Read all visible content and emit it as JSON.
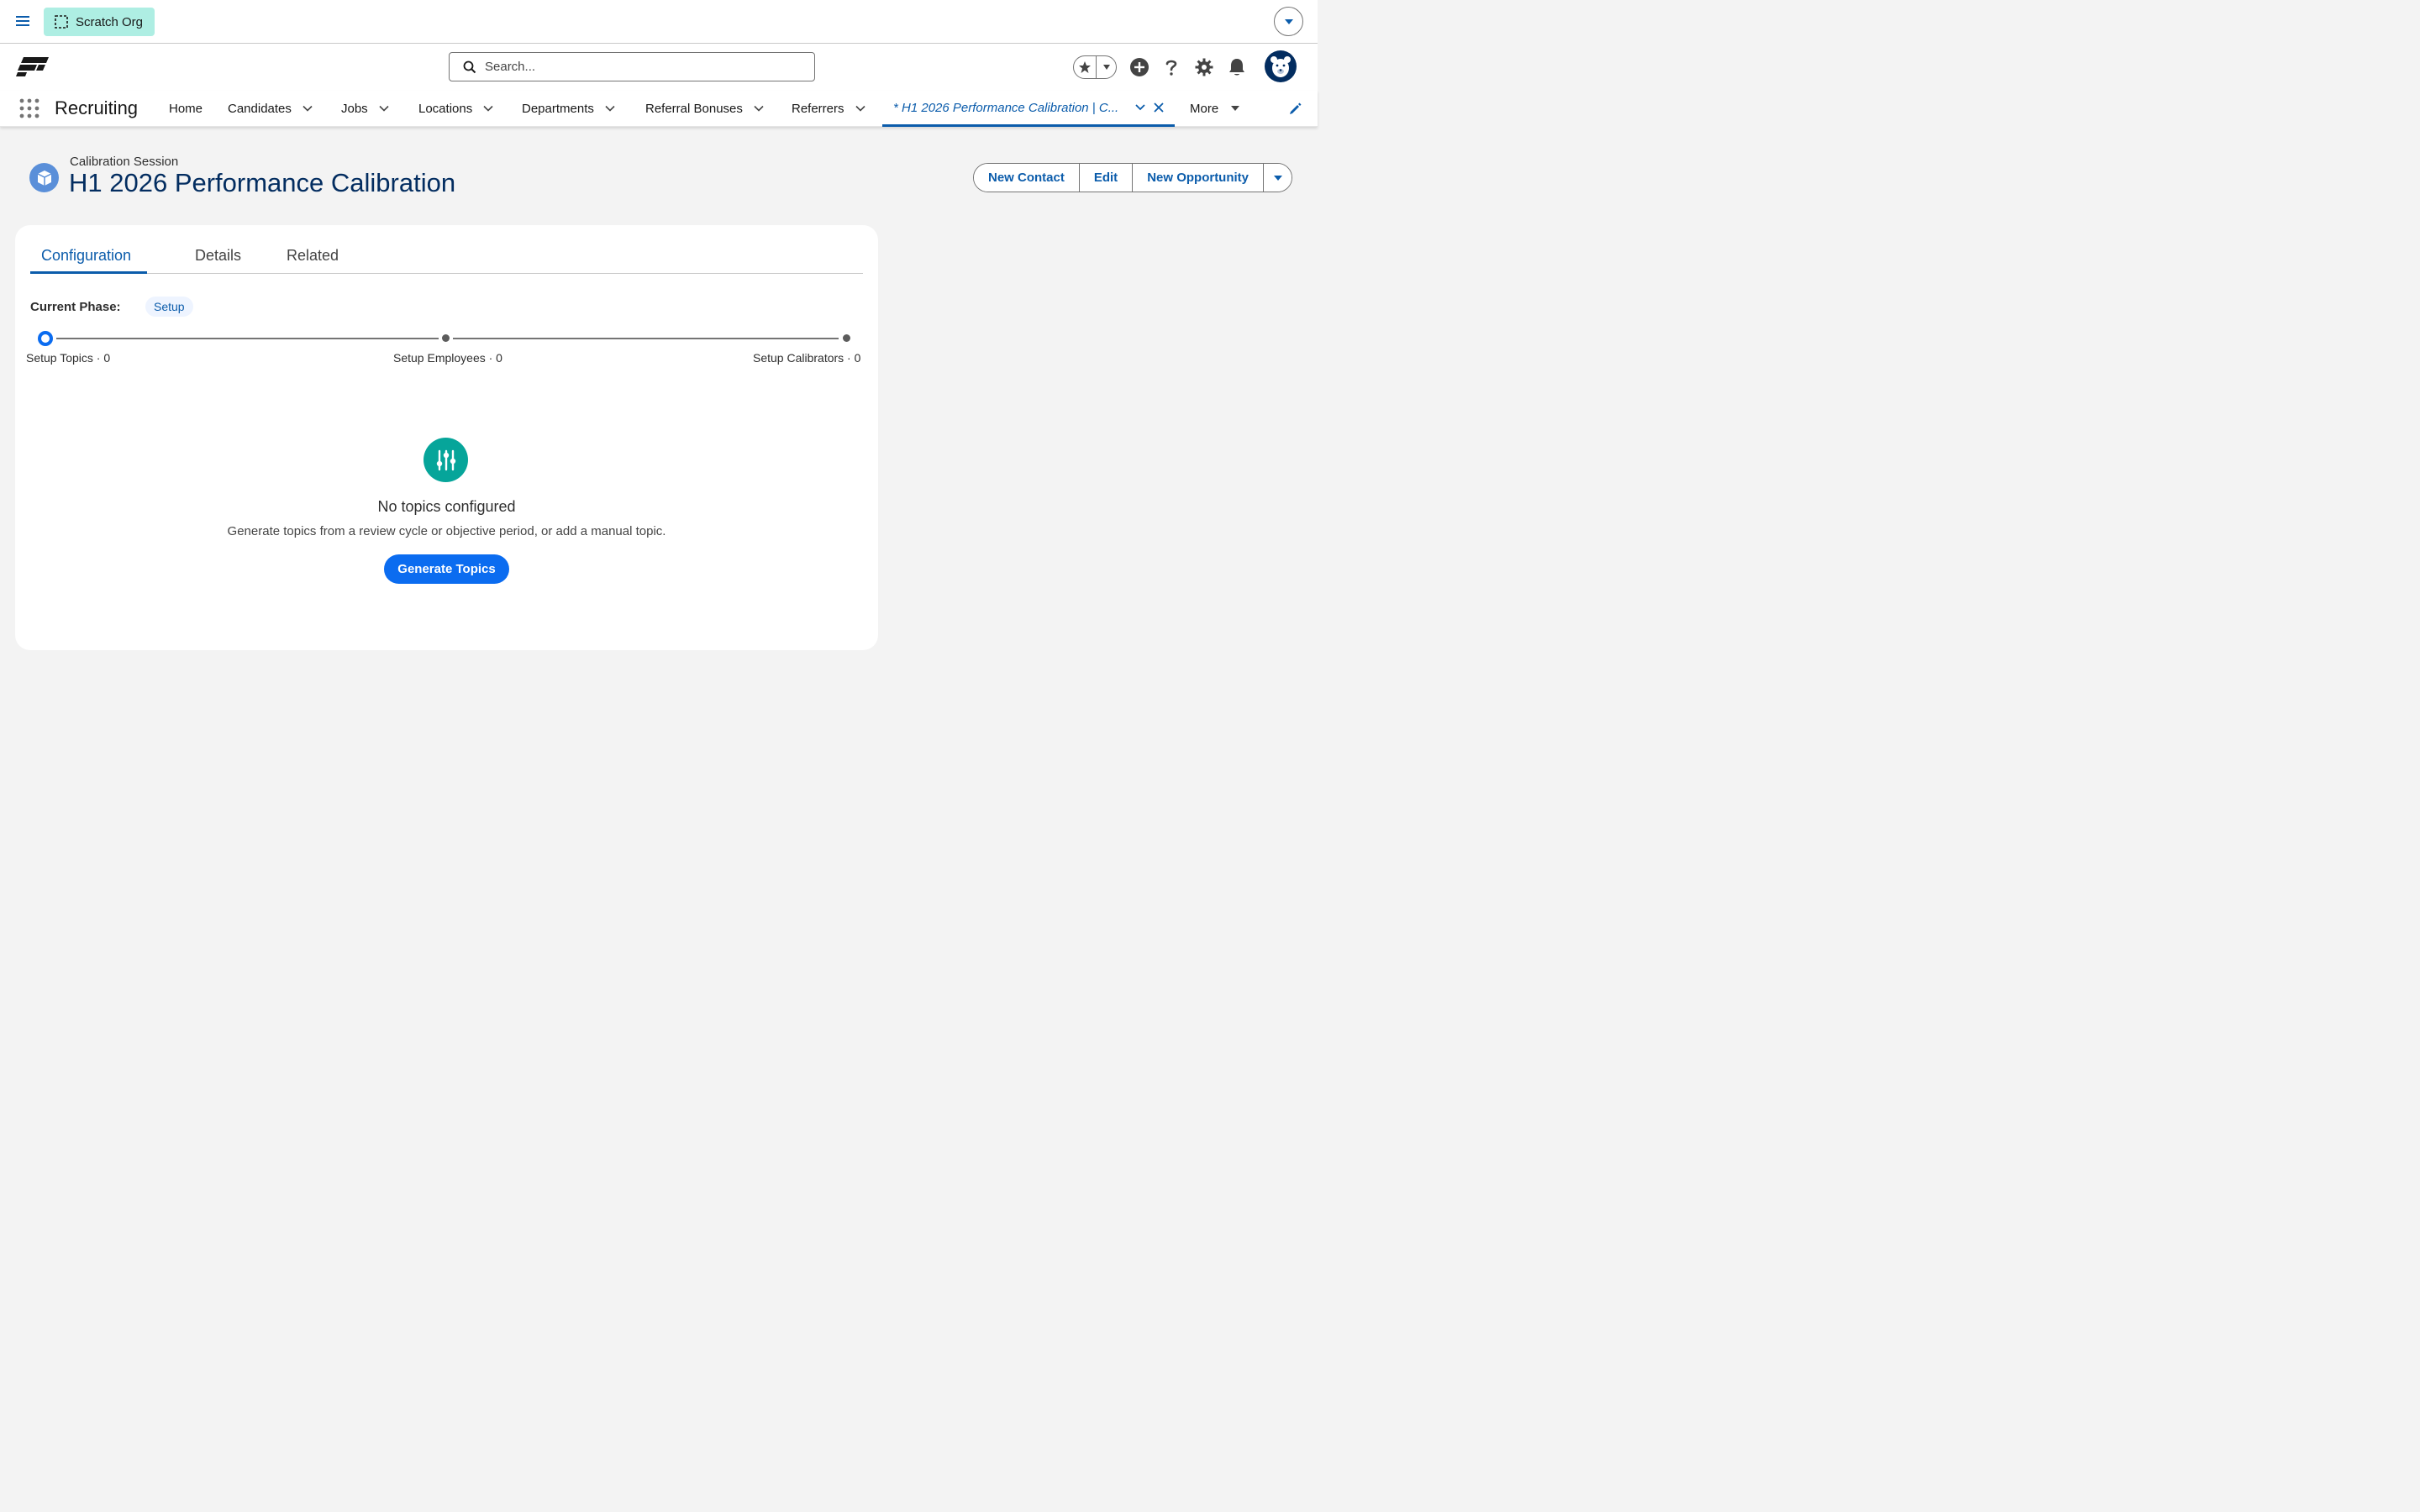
{
  "org_pill": {
    "label": "Scratch Org"
  },
  "search": {
    "placeholder": "Search..."
  },
  "app": {
    "name": "Recruiting"
  },
  "nav": {
    "items": [
      {
        "label": "Home"
      },
      {
        "label": "Candidates"
      },
      {
        "label": "Jobs"
      },
      {
        "label": "Locations"
      },
      {
        "label": "Departments"
      },
      {
        "label": "Referral Bonuses"
      },
      {
        "label": "Referrers"
      }
    ],
    "active_tab": "* H1 2026 Performance Calibration | C...",
    "more": "More"
  },
  "record": {
    "type": "Calibration Session",
    "title": "H1 2026 Performance Calibration",
    "actions": [
      "New Contact",
      "Edit",
      "New Opportunity"
    ]
  },
  "tabs": [
    "Configuration",
    "Details",
    "Related"
  ],
  "phase": {
    "label": "Current Phase:",
    "value": "Setup",
    "steps": [
      "Setup Topics · 0",
      "Setup Employees · 0",
      "Setup Calibrators · 0"
    ]
  },
  "empty_state": {
    "title": "No topics configured",
    "description": "Generate topics from a review cycle or objective period, or add a manual topic.",
    "button": "Generate Topics"
  },
  "colors": {
    "brand": "#0b5cab",
    "brand_button": "#0b6cf0",
    "org_pill": "#aeeee3",
    "empty_icon": "#06a59a",
    "title": "#032d60"
  }
}
